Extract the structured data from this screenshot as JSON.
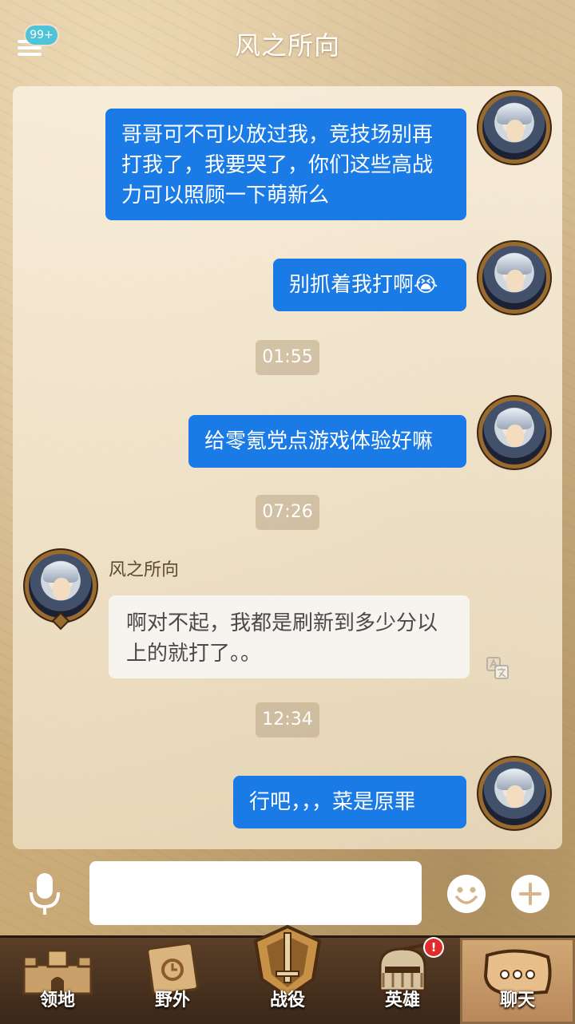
{
  "header": {
    "title": "风之所向",
    "badge": "99+"
  },
  "messages": [
    {
      "type": "out",
      "text": "哥哥可不可以放过我，竞技场别再打我了，我要哭了，你们这些高战力可以照顾一下萌新么"
    },
    {
      "type": "out",
      "text": "别抓着我打啊😭"
    },
    {
      "type": "time",
      "text": "01:55"
    },
    {
      "type": "out",
      "text": "给零氪党点游戏体验好嘛"
    },
    {
      "type": "time",
      "text": "07:26"
    },
    {
      "type": "in",
      "sender": "风之所向",
      "text": "啊对不起，我都是刷新到多少分以上的就打了。。"
    },
    {
      "type": "time",
      "text": "12:34"
    },
    {
      "type": "out",
      "text": "行吧，，，菜是原罪"
    }
  ],
  "input": {
    "value": "",
    "placeholder": ""
  },
  "nav": {
    "items": [
      {
        "label": "领地",
        "icon": "castle-icon"
      },
      {
        "label": "野外",
        "icon": "scroll-map-icon"
      },
      {
        "label": "战役",
        "icon": "sword-shield-icon"
      },
      {
        "label": "英雄",
        "icon": "helmet-icon",
        "badge": "!"
      },
      {
        "label": "聊天",
        "icon": "chat-bubble-icon",
        "active": true
      }
    ]
  },
  "colors": {
    "outgoing_bubble": "#1a7ae6",
    "incoming_bubble": "#f7f3ee",
    "badge_blue": "#4fc3d8",
    "alert_red": "#e12c2c"
  }
}
